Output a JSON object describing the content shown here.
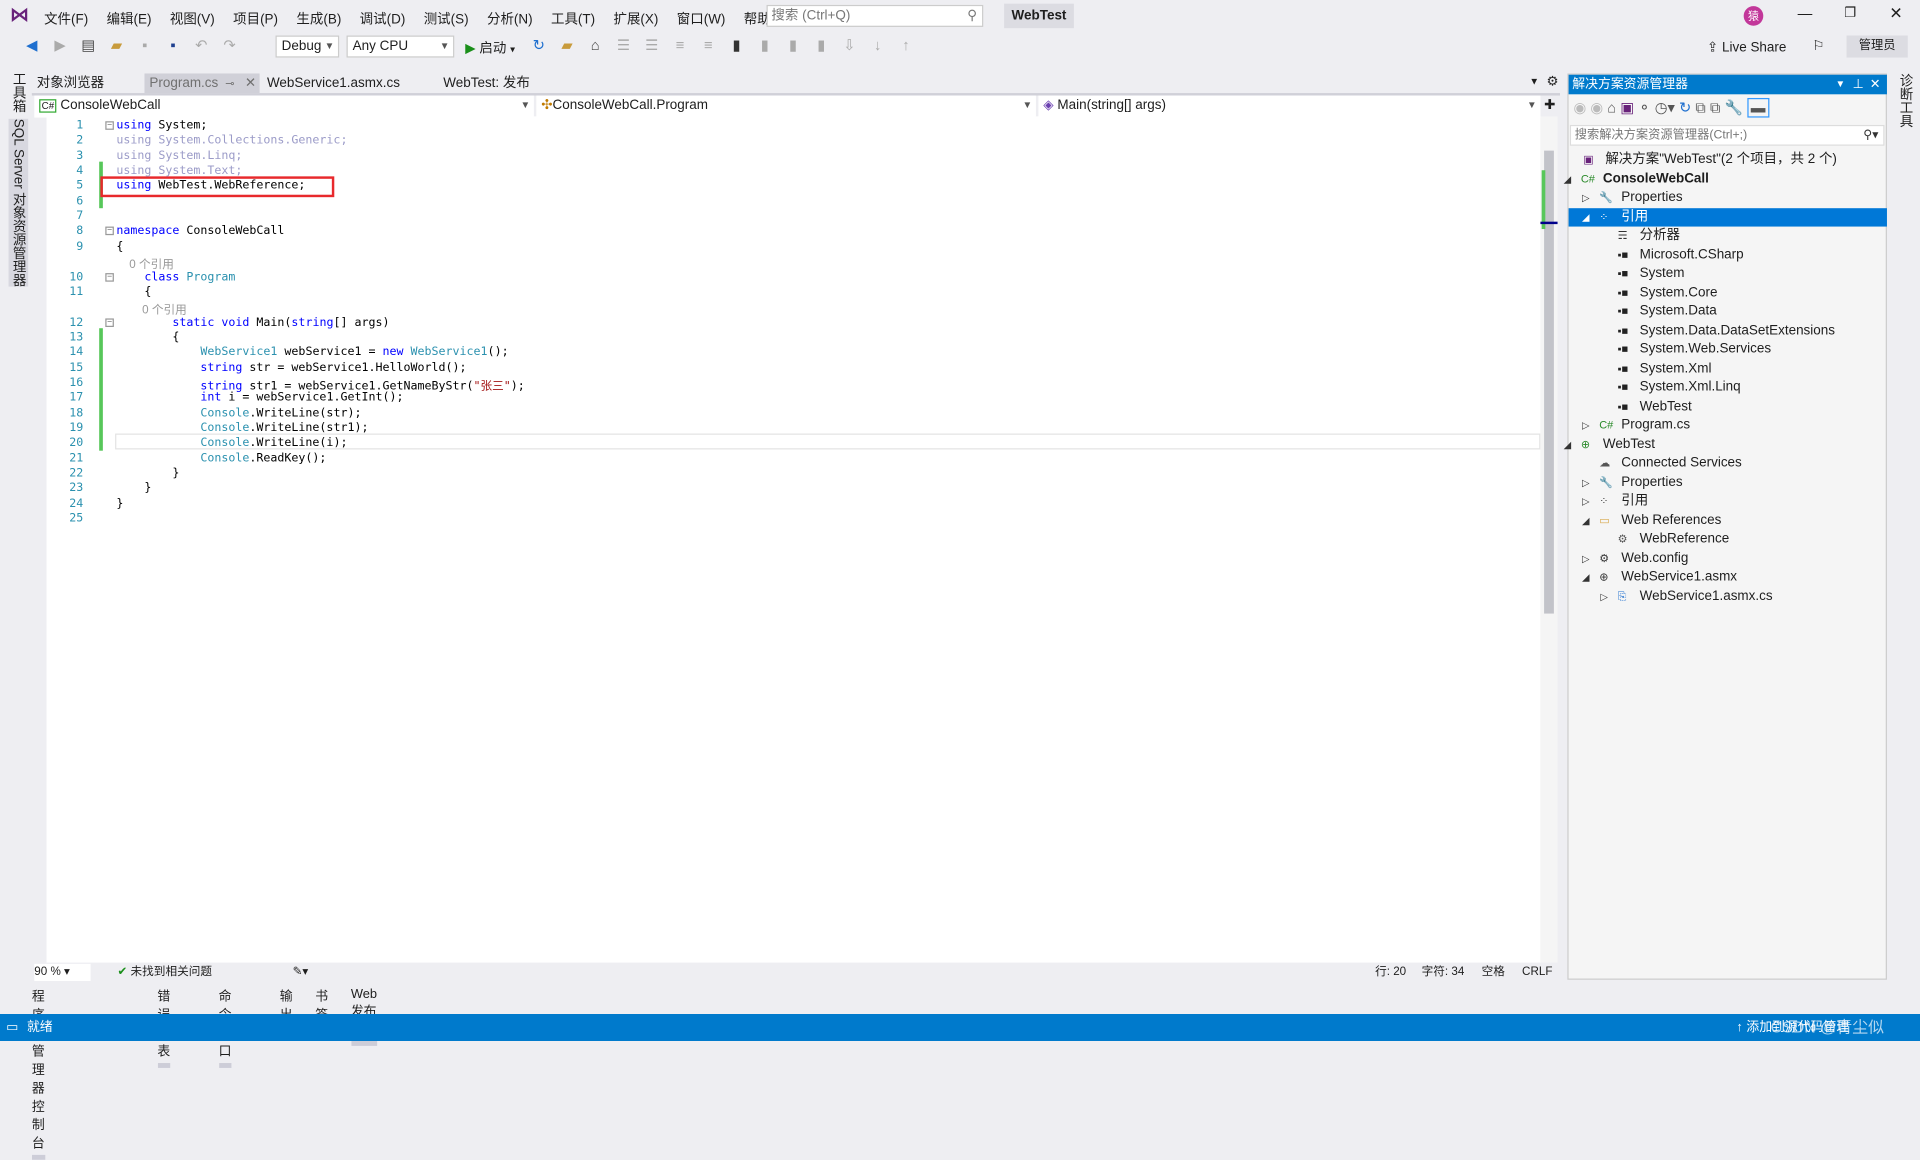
{
  "title_bar": {
    "menus": [
      "文件(F)",
      "编辑(E)",
      "视图(V)",
      "项目(P)",
      "生成(B)",
      "调试(D)",
      "测试(S)",
      "分析(N)",
      "工具(T)",
      "扩展(X)",
      "窗口(W)",
      "帮助(H)"
    ],
    "search_placeholder": "搜索 (Ctrl+Q)",
    "solution_name": "WebTest",
    "avatar": "猿",
    "brand_color": "#68217a"
  },
  "toolbar": {
    "config": "Debug",
    "platform": "Any CPU",
    "start_label": "启动",
    "live_share": "Live Share",
    "admin": "管理员"
  },
  "left_strip": [
    "工具箱",
    "SQL Server 对象资源管理器"
  ],
  "right_strip": [
    "诊断工具"
  ],
  "tabs": [
    {
      "label": "对象浏览器"
    },
    {
      "label": "Program.cs",
      "active": true
    },
    {
      "label": "WebService1.asmx.cs"
    },
    {
      "label": "WebTest: 发布"
    }
  ],
  "nav": {
    "project": "ConsoleWebCall",
    "class": "ConsoleWebCall.Program",
    "member": "Main(string[] args)"
  },
  "code": [
    {
      "n": "1",
      "t": [
        [
          "using",
          "kw"
        ],
        [
          " System;",
          "pl"
        ]
      ]
    },
    {
      "n": "2",
      "t": [
        [
          "using System.Collections.Generic;",
          "fd"
        ]
      ]
    },
    {
      "n": "3",
      "t": [
        [
          "using System.Linq;",
          "fd"
        ]
      ]
    },
    {
      "n": "4",
      "t": [
        [
          "using System.Text;",
          "fd"
        ]
      ]
    },
    {
      "n": "5",
      "t": [
        [
          "using",
          "kw"
        ],
        [
          " WebTest.WebReference;",
          "pl"
        ]
      ]
    },
    {
      "n": "6",
      "t": []
    },
    {
      "n": "7",
      "t": []
    },
    {
      "n": "8",
      "t": [
        [
          "namespace",
          "kw"
        ],
        [
          " ConsoleWebCall",
          "pl"
        ]
      ]
    },
    {
      "n": "9",
      "t": [
        [
          "{",
          "pl"
        ]
      ]
    },
    {
      "n": "",
      "t": [
        [
          "    0 个引用",
          "lens"
        ]
      ]
    },
    {
      "n": "10",
      "t": [
        [
          "    class",
          "kw"
        ],
        [
          " Program",
          "ty"
        ]
      ]
    },
    {
      "n": "11",
      "t": [
        [
          "    {",
          "pl"
        ]
      ]
    },
    {
      "n": "",
      "t": [
        [
          "        0 个引用",
          "lens"
        ]
      ]
    },
    {
      "n": "12",
      "t": [
        [
          "        static void",
          "kw"
        ],
        [
          " Main(",
          "pl"
        ],
        [
          "string",
          "kw"
        ],
        [
          "[] args)",
          "pl"
        ]
      ]
    },
    {
      "n": "13",
      "t": [
        [
          "        {",
          "pl"
        ]
      ]
    },
    {
      "n": "14",
      "t": [
        [
          "            WebService1",
          "ty"
        ],
        [
          " webService1 = ",
          "pl"
        ],
        [
          "new",
          "kw"
        ],
        [
          " WebService1",
          "ty"
        ],
        [
          "();",
          "pl"
        ]
      ]
    },
    {
      "n": "15",
      "t": [
        [
          "            string",
          "kw"
        ],
        [
          " str = webService1.HelloWorld();",
          "pl"
        ]
      ]
    },
    {
      "n": "16",
      "t": [
        [
          "            string",
          "kw"
        ],
        [
          " str1 = webService1.GetNameByStr(",
          "pl"
        ],
        [
          "\"张三\"",
          "st"
        ],
        [
          ");",
          "pl"
        ]
      ]
    },
    {
      "n": "17",
      "t": [
        [
          "            int",
          "kw"
        ],
        [
          " i = webService1.GetInt();",
          "pl"
        ]
      ]
    },
    {
      "n": "18",
      "t": [
        [
          "            Console",
          "ty"
        ],
        [
          ".WriteLine(str);",
          "pl"
        ]
      ]
    },
    {
      "n": "19",
      "t": [
        [
          "            Console",
          "ty"
        ],
        [
          ".WriteLine(str1);",
          "pl"
        ]
      ]
    },
    {
      "n": "20",
      "t": [
        [
          "            Console",
          "ty"
        ],
        [
          ".WriteLine(i);",
          "pl"
        ]
      ]
    },
    {
      "n": "21",
      "t": [
        [
          "            Console",
          "ty"
        ],
        [
          ".ReadKey();",
          "pl"
        ]
      ]
    },
    {
      "n": "22",
      "t": [
        [
          "        }",
          "pl"
        ]
      ]
    },
    {
      "n": "23",
      "t": [
        [
          "    }",
          "pl"
        ]
      ]
    },
    {
      "n": "24",
      "t": [
        [
          "}",
          "pl"
        ]
      ]
    },
    {
      "n": "25",
      "t": []
    }
  ],
  "editor_status": {
    "zoom": "90 %",
    "issues": "未找到相关问题",
    "line": "行: 20",
    "char": "字符: 34",
    "spaces": "空格",
    "eol": "CRLF"
  },
  "bottom_tabs": [
    "程序包管理器控制台",
    "错误列表",
    "命令窗口",
    "输出",
    "书签",
    "Web 发布活动"
  ],
  "status_bar": {
    "text": "就绪",
    "right": "添加到源代码管理",
    "watermark": "CSDN @青尘似",
    "color": "#007acc"
  },
  "solution_explorer": {
    "title": "解决方案资源管理器",
    "search_placeholder": "搜索解决方案资源管理器(Ctrl+;)",
    "items": [
      {
        "label": "解决方案\"WebTest\"(2 个项目，共 2 个)",
        "level": 0,
        "icon": "solution-icon",
        "tw": ""
      },
      {
        "label": "ConsoleWebCall",
        "level": 1,
        "icon": "csharp-project-icon",
        "tw": "◢",
        "bold": true
      },
      {
        "label": "Properties",
        "level": 2,
        "icon": "wrench-icon",
        "tw": "▷"
      },
      {
        "label": "引用",
        "level": 2,
        "icon": "references-icon",
        "tw": "◢",
        "selected": true
      },
      {
        "label": "分析器",
        "level": 3,
        "icon": "analyzer-icon",
        "tw": ""
      },
      {
        "label": "Microsoft.CSharp",
        "level": 3,
        "icon": "assembly-icon",
        "tw": ""
      },
      {
        "label": "System",
        "level": 3,
        "icon": "assembly-icon",
        "tw": ""
      },
      {
        "label": "System.Core",
        "level": 3,
        "icon": "assembly-icon",
        "tw": ""
      },
      {
        "label": "System.Data",
        "level": 3,
        "icon": "assembly-icon",
        "tw": ""
      },
      {
        "label": "System.Data.DataSetExtensions",
        "level": 3,
        "icon": "assembly-icon",
        "tw": ""
      },
      {
        "label": "System.Web.Services",
        "level": 3,
        "icon": "assembly-icon",
        "tw": ""
      },
      {
        "label": "System.Xml",
        "level": 3,
        "icon": "assembly-icon",
        "tw": ""
      },
      {
        "label": "System.Xml.Linq",
        "level": 3,
        "icon": "assembly-icon",
        "tw": ""
      },
      {
        "label": "WebTest",
        "level": 3,
        "icon": "assembly-icon",
        "tw": ""
      },
      {
        "label": "Program.cs",
        "level": 2,
        "icon": "csharp-file-icon",
        "tw": "▷"
      },
      {
        "label": "WebTest",
        "level": 1,
        "icon": "web-project-icon",
        "tw": "◢"
      },
      {
        "label": "Connected Services",
        "level": 2,
        "icon": "connected-services-icon",
        "tw": ""
      },
      {
        "label": "Properties",
        "level": 2,
        "icon": "wrench-icon",
        "tw": "▷"
      },
      {
        "label": "引用",
        "level": 2,
        "icon": "references-icon",
        "tw": "▷"
      },
      {
        "label": "Web References",
        "level": 2,
        "icon": "folder-icon",
        "tw": "◢"
      },
      {
        "label": "WebReference",
        "level": 3,
        "icon": "web-reference-icon",
        "tw": ""
      },
      {
        "label": "Web.config",
        "level": 2,
        "icon": "config-icon",
        "tw": "▷"
      },
      {
        "label": "WebService1.asmx",
        "level": 2,
        "icon": "globe-icon",
        "tw": "◢"
      },
      {
        "label": "WebService1.asmx.cs",
        "level": 3,
        "icon": "cs-file-icon",
        "tw": "▷"
      }
    ]
  }
}
